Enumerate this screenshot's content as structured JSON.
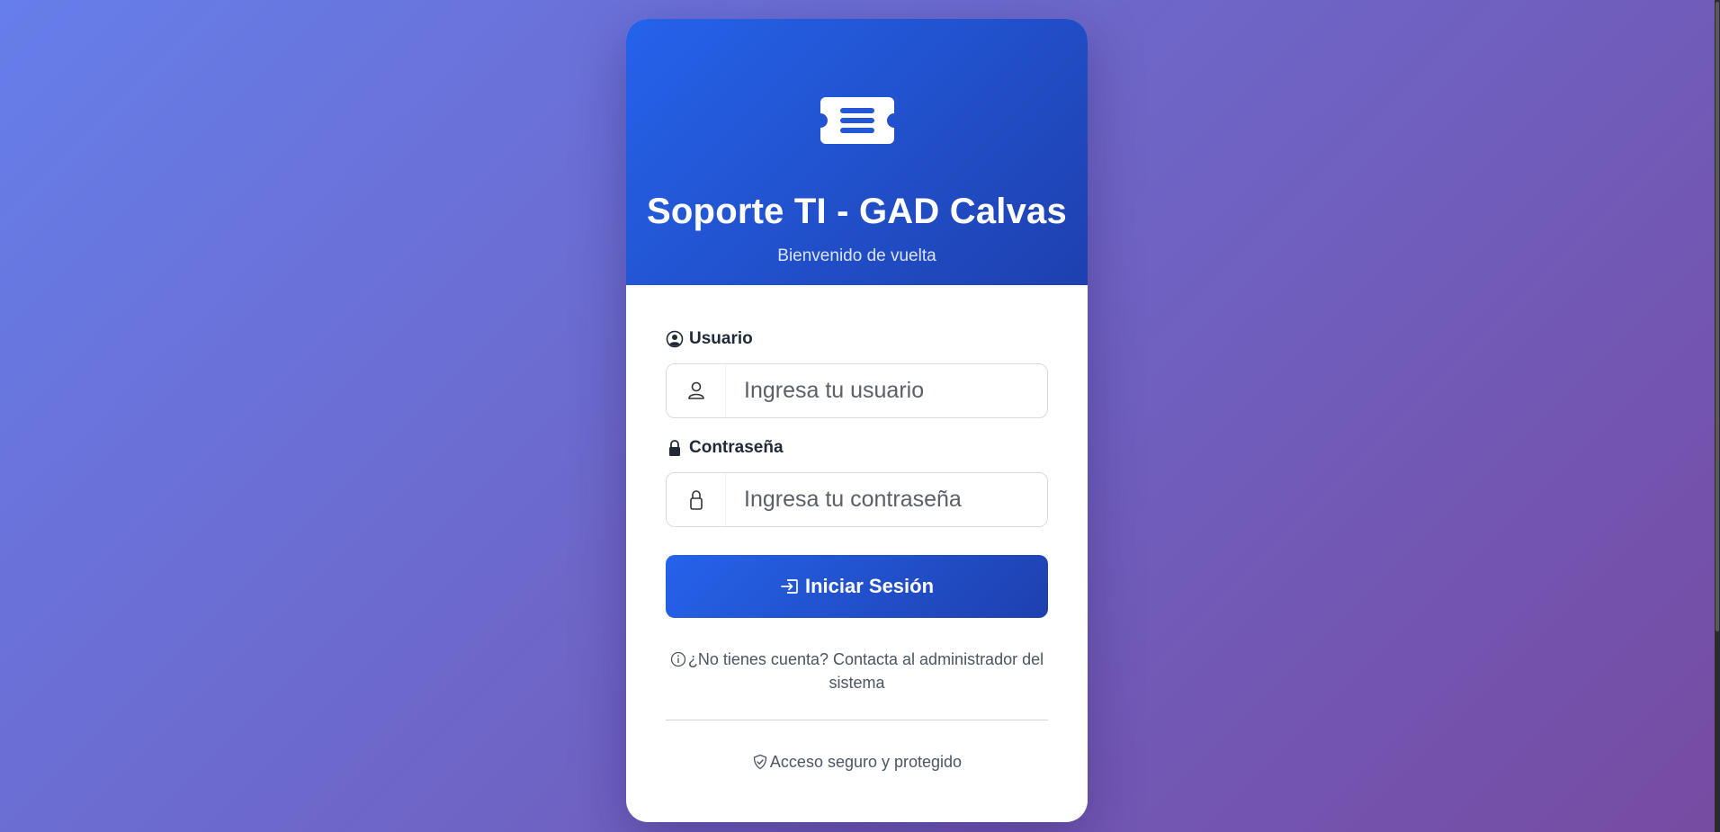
{
  "header": {
    "icon": "ticket-icon",
    "title": "Soporte TI - GAD Calvas",
    "subtitle": "Bienvenido de vuelta"
  },
  "form": {
    "username": {
      "label": "Usuario",
      "label_icon": "person-circle-icon",
      "addon_icon": "person-icon",
      "placeholder": "Ingresa tu usuario",
      "value": ""
    },
    "password": {
      "label": "Contraseña",
      "label_icon": "lock-fill-icon",
      "addon_icon": "lock-icon",
      "placeholder": "Ingresa tu contraseña",
      "value": ""
    },
    "submit_label": "Iniciar Sesión",
    "submit_icon": "box-arrow-in-right-icon"
  },
  "footer": {
    "help_icon": "info-circle-icon",
    "help_text": "¿No tienes cuenta? Contacta al administrador del sistema",
    "secure_icon": "shield-check-icon",
    "secure_text": "Acceso seguro y protegido"
  },
  "colors": {
    "background_start": "#667eea",
    "background_end": "#764ba2",
    "header_start": "#2563eb",
    "header_end": "#1e40af"
  }
}
